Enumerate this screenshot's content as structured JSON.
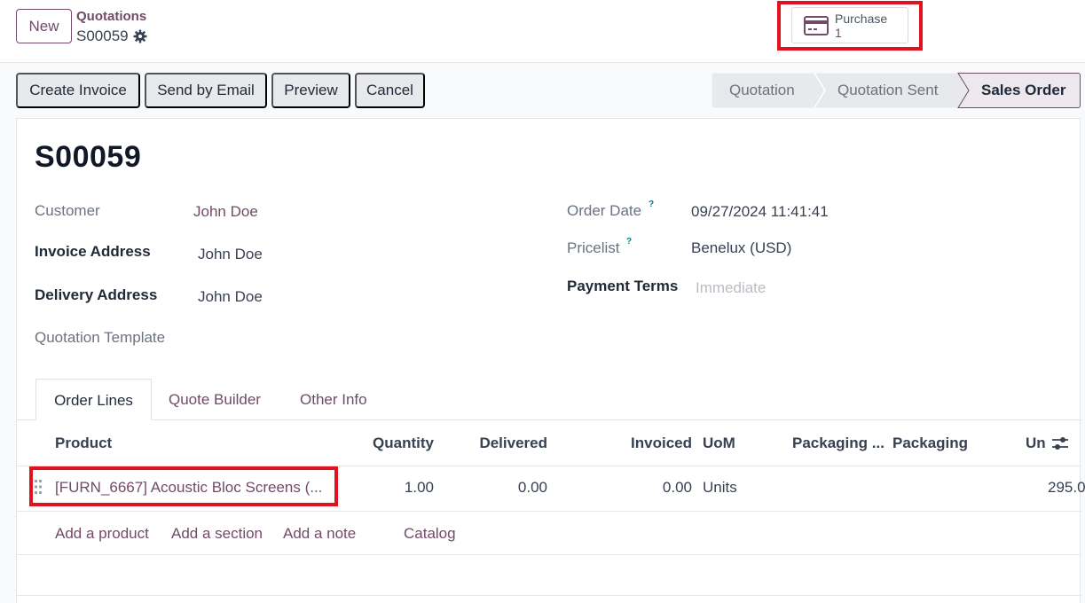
{
  "header": {
    "new_label": "New",
    "breadcrumb_parent": "Quotations",
    "breadcrumb_current": "S00059"
  },
  "smart_button": {
    "label": "Purchase",
    "value": "1",
    "icon": "credit-card-icon"
  },
  "actions": {
    "create_invoice": "Create Invoice",
    "send_email": "Send by Email",
    "preview": "Preview",
    "cancel": "Cancel"
  },
  "status": {
    "stages": [
      "Quotation",
      "Quotation Sent",
      "Sales Order"
    ],
    "active": "Sales Order"
  },
  "form": {
    "name": "S00059",
    "customer_label": "Customer",
    "customer": "John Doe",
    "invoice_address_label": "Invoice Address",
    "invoice_address": "John Doe",
    "delivery_address_label": "Delivery Address",
    "delivery_address": "John Doe",
    "quotation_template_label": "Quotation Template",
    "order_date_label": "Order Date",
    "order_date": "09/27/2024 11:41:41",
    "pricelist_label": "Pricelist",
    "pricelist": "Benelux (USD)",
    "payment_terms_label": "Payment Terms",
    "payment_terms_placeholder": "Immediate",
    "help_mark": "?"
  },
  "tabs": [
    "Order Lines",
    "Quote Builder",
    "Other Info"
  ],
  "table": {
    "columns": [
      "Product",
      "Quantity",
      "Delivered",
      "Invoiced",
      "UoM",
      "Packaging ...",
      "Packaging",
      "Un"
    ],
    "rows": [
      {
        "product": "[FURN_6667] Acoustic Bloc Screens (...",
        "quantity": "1.00",
        "delivered": "0.00",
        "invoiced": "0.00",
        "uom": "Units",
        "unit_price": "295.0"
      }
    ],
    "add_links": [
      "Add a product",
      "Add a section",
      "Add a note",
      "Catalog"
    ]
  },
  "colors": {
    "brand": "#714b67",
    "highlight": "#e0121d",
    "tooltip": "#017e84"
  }
}
